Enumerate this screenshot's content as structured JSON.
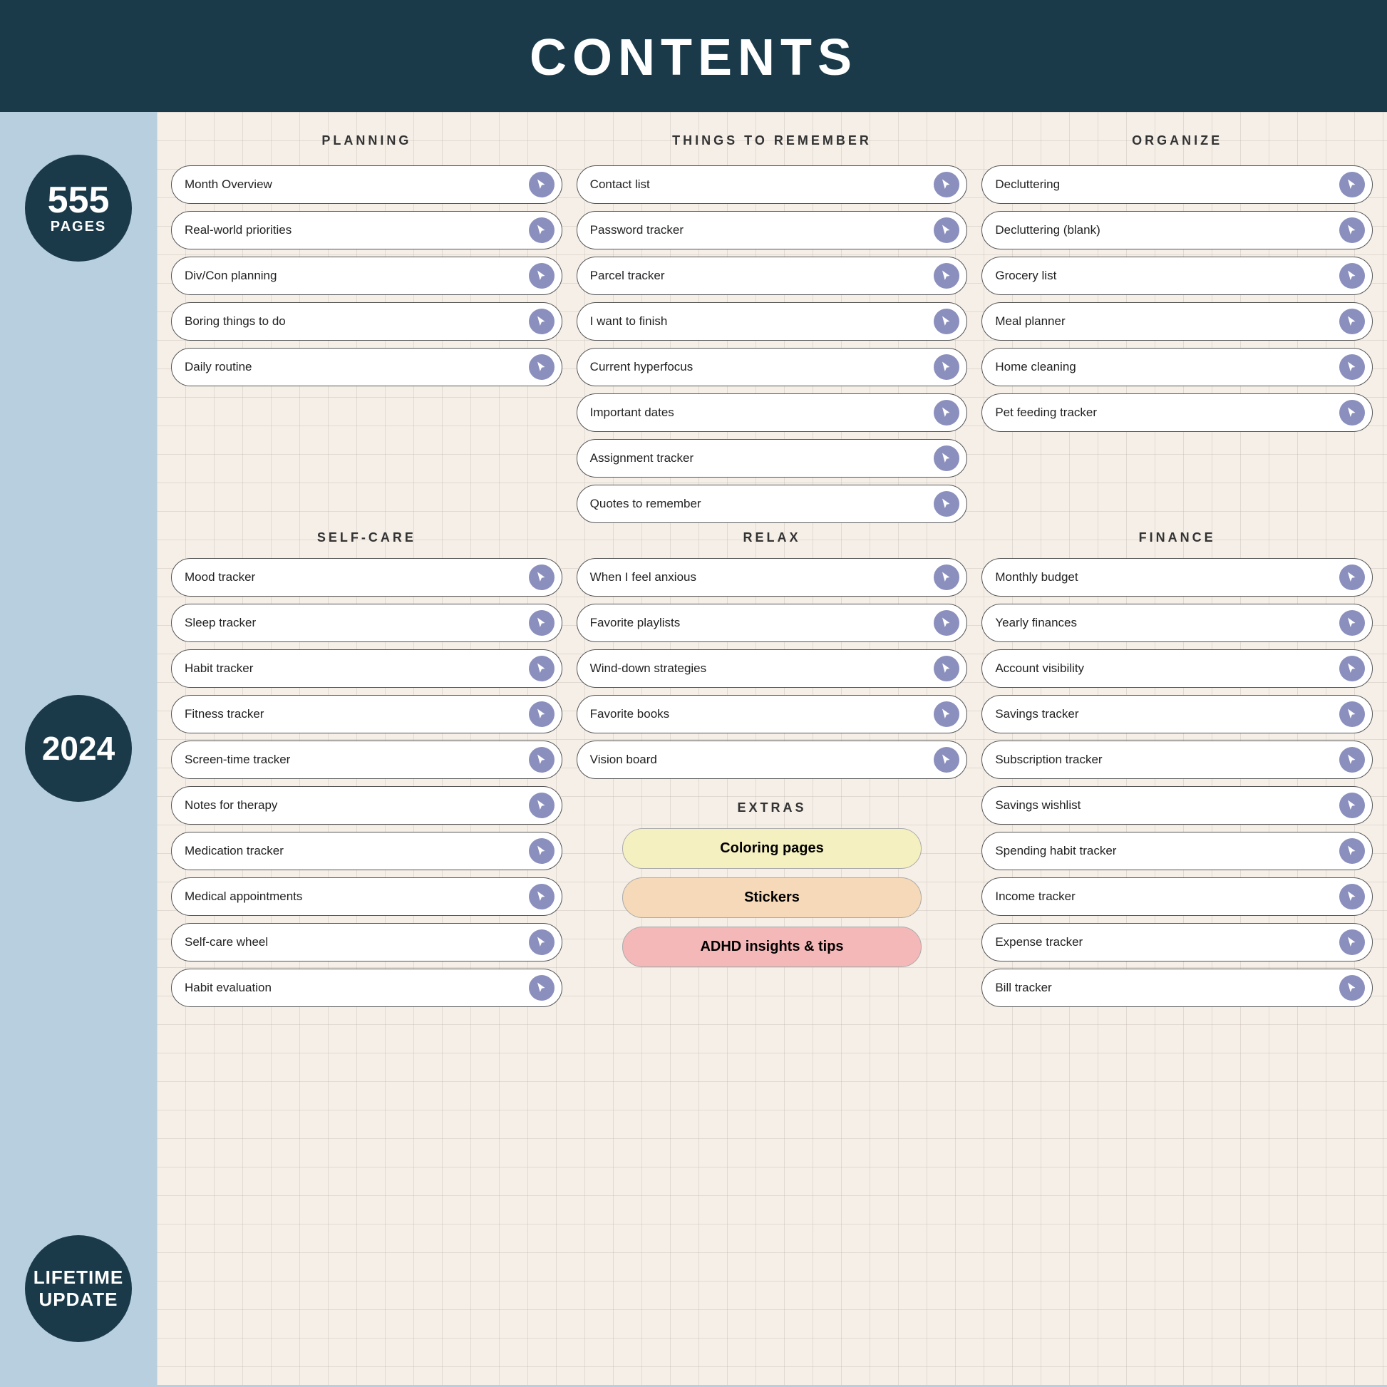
{
  "header": {
    "title": "CONTENTS"
  },
  "sidebar": {
    "pages_number": "555",
    "pages_label": "PAGES",
    "year": "2024",
    "lifetime_label": "LIFETIME\nUPDATE"
  },
  "planning": {
    "section_title": "PLANNING",
    "items": [
      "Month Overview",
      "Real-world priorities",
      "Div/Con planning",
      "Boring things to do",
      "Daily routine"
    ]
  },
  "things_to_remember": {
    "section_title": "THINGS TO REMEMBER",
    "items": [
      "Contact list",
      "Password tracker",
      "Parcel tracker",
      "I want to finish",
      "Current hyperfocus",
      "Important dates",
      "Assignment tracker",
      "Quotes to remember"
    ]
  },
  "organize": {
    "section_title": "ORGANIZE",
    "items": [
      "Decluttering",
      "Decluttering (blank)",
      "Grocery list",
      "Meal planner",
      "Home cleaning",
      "Pet feeding tracker"
    ]
  },
  "self_care": {
    "section_title": "SELF-CARE",
    "items": [
      "Mood tracker",
      "Sleep tracker",
      "Habit tracker",
      "Fitness tracker",
      "Screen-time tracker",
      "Notes for therapy",
      "Medication tracker",
      "Medical appointments",
      "Self-care wheel",
      "Habit evaluation"
    ]
  },
  "relax": {
    "section_title": "RELAX",
    "items": [
      "When I feel anxious",
      "Favorite playlists",
      "Wind-down strategies",
      "Favorite books",
      "Vision board"
    ]
  },
  "finance": {
    "section_title": "FINANCE",
    "items": [
      "Monthly budget",
      "Yearly finances",
      "Account visibility",
      "Savings tracker",
      "Subscription tracker",
      "Savings wishlist",
      "Spending habit tracker",
      "Income tracker",
      "Expense tracker",
      "Bill tracker"
    ]
  },
  "extras": {
    "section_title": "EXTRAS",
    "buttons": [
      {
        "label": "Coloring pages",
        "style": "yellow"
      },
      {
        "label": "Stickers",
        "style": "peach"
      },
      {
        "label": "ADHD insights & tips",
        "style": "pink"
      }
    ]
  }
}
